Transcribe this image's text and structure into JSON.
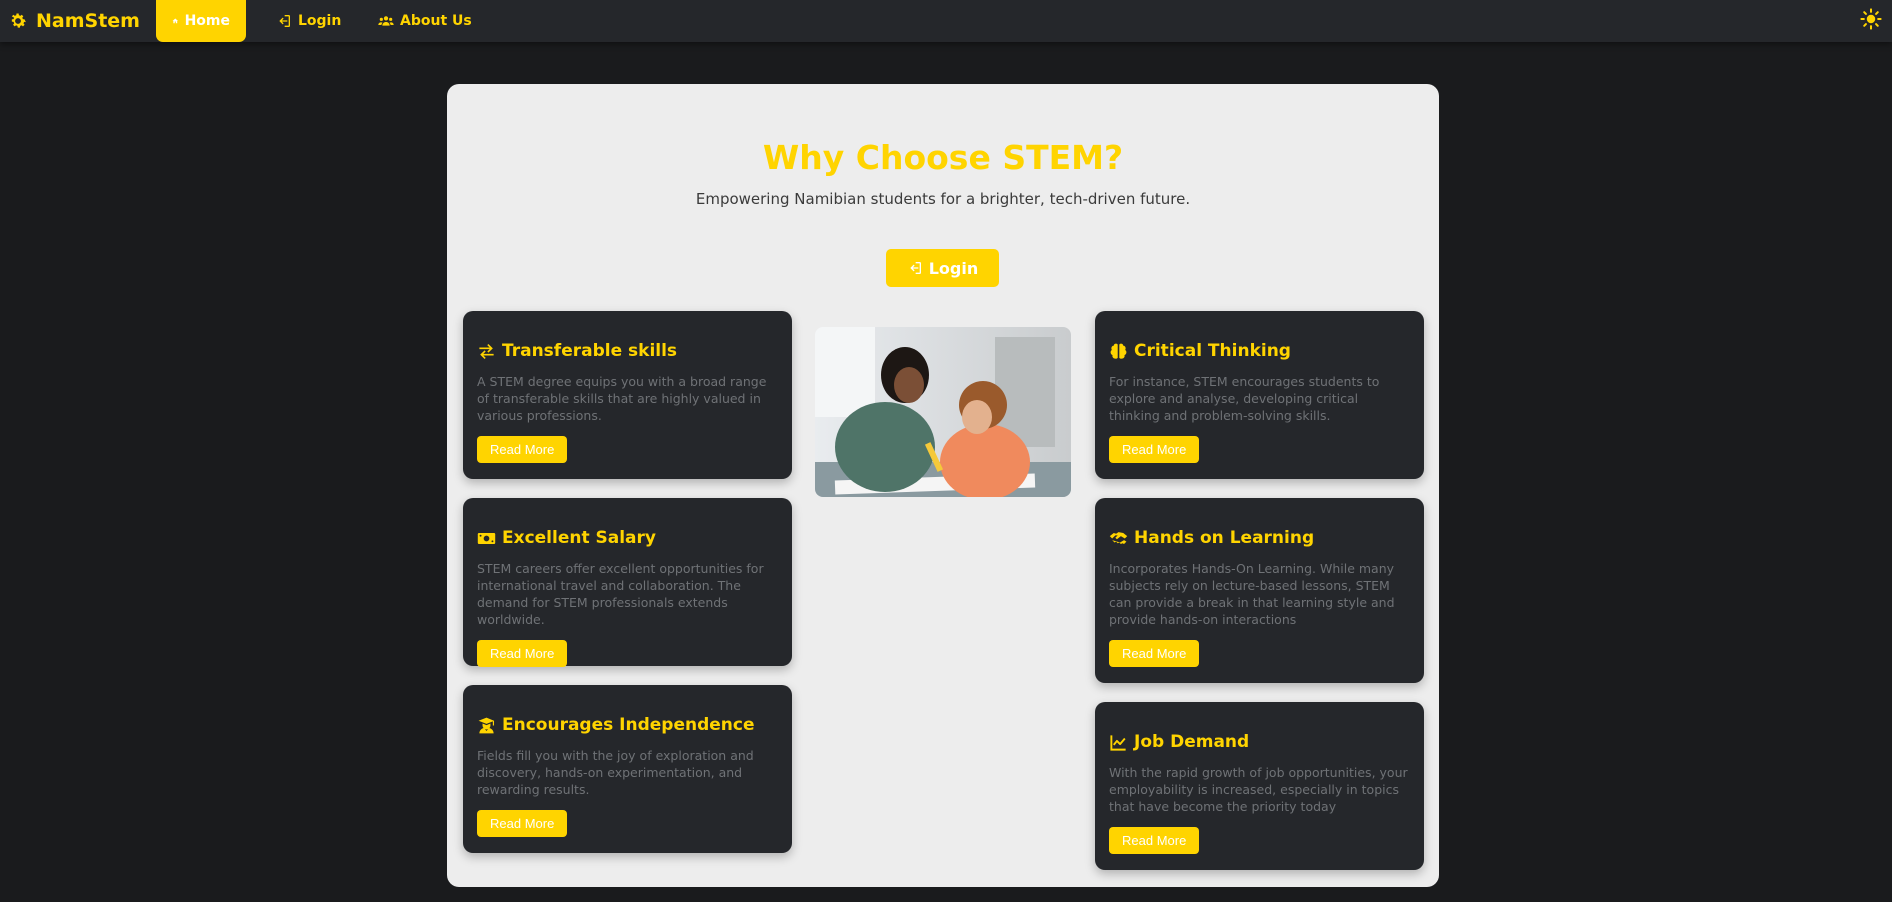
{
  "navbar": {
    "brand": "NamStem",
    "items": [
      {
        "label": "Home",
        "icon": "home-icon",
        "active": true
      },
      {
        "label": "Login",
        "icon": "sign-in-icon",
        "active": false
      },
      {
        "label": "About Us",
        "icon": "users-icon",
        "active": false
      }
    ],
    "theme_toggle_icon": "sun-icon"
  },
  "hero": {
    "title": "Why Choose STEM?",
    "subtitle": "Empowering Namibian students for a brighter, tech-driven future.",
    "login_label": "Login"
  },
  "cards": [
    {
      "title": "Transferable skills",
      "icon": "exchange-icon",
      "text": "A STEM degree equips you with a broad range of transferable skills that are highly valued in various professions.",
      "button": "Read More"
    },
    {
      "title": "Excellent Salary",
      "icon": "money-icon",
      "text": "STEM careers offer excellent opportunities for international travel and collaboration. The demand for STEM professionals extends worldwide.",
      "button": "Read More"
    },
    {
      "title": "Encourages Independence",
      "icon": "graduate-icon",
      "text": "Fields fill you with the joy of exploration and discovery, hands-on experimentation, and rewarding results.",
      "button": "Read More"
    },
    {
      "title": "Critical Thinking",
      "icon": "brain-icon",
      "text": "For instance, STEM encourages students to explore and analyse, developing critical thinking and problem-solving skills.",
      "button": "Read More"
    },
    {
      "title": "Hands on Learning",
      "icon": "handshake-icon",
      "text": "Incorporates Hands-On Learning. While many subjects rely on lecture-based lessons, STEM can provide a break in that learning style and provide hands-on interactions",
      "button": "Read More"
    },
    {
      "title": "Job Demand",
      "icon": "chart-line-icon",
      "text": "With the rapid growth of job opportunities, your employability is increased, especially in topics that have become the priority today",
      "button": "Read More"
    }
  ],
  "colors": {
    "accent": "#ffd400",
    "nav_bg": "#25272b",
    "page_bg": "#1a1b1d",
    "panel_bg": "#ededed",
    "card_bg": "#25272b"
  }
}
